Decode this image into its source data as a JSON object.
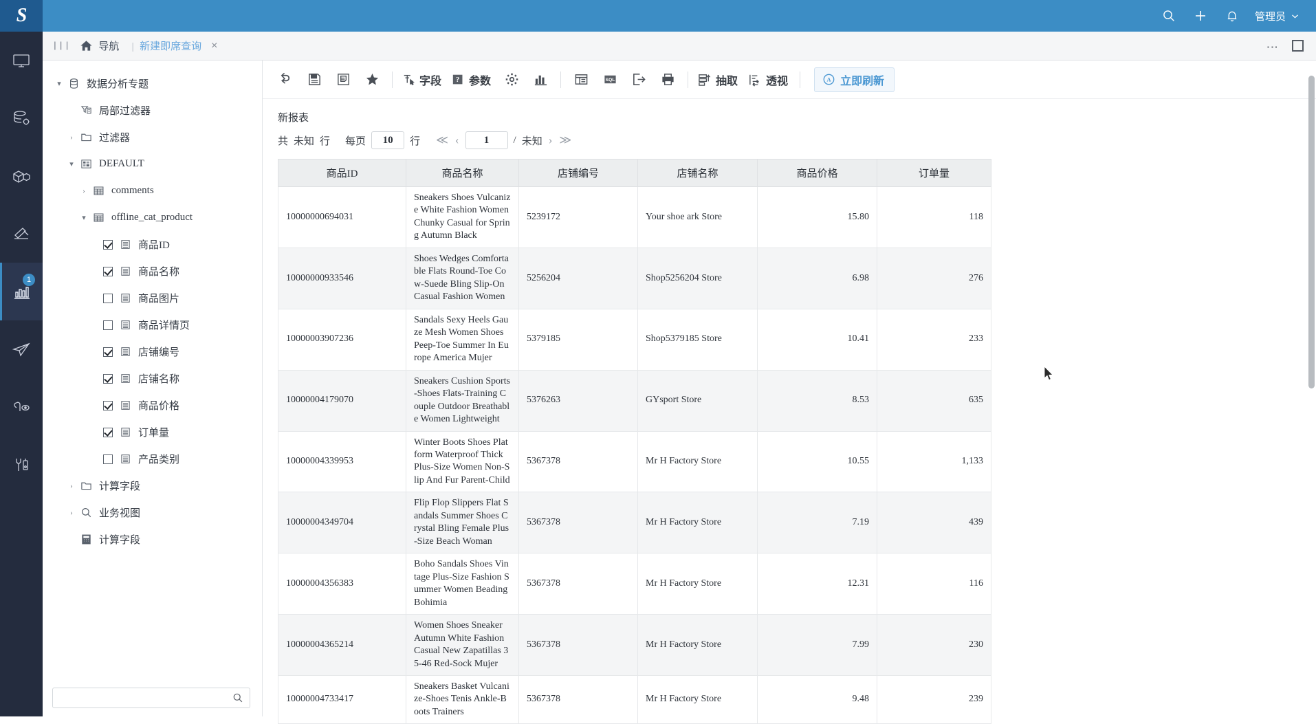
{
  "header": {
    "logo": "S",
    "search_icon": "search-icon",
    "add_icon": "plus-icon",
    "bell_icon": "bell-icon",
    "user_label": "管理员",
    "chevron": "⌄",
    "brand_color": "#3c8dc5"
  },
  "tabbar": {
    "menu_icon": "|||",
    "home_label": "导航",
    "separator": "|",
    "tab_label": "新建即席查询",
    "close_icon": "×",
    "more_icon": "⋮",
    "maximize_icon": "maximize-icon"
  },
  "rail": {
    "items": [
      {
        "name": "monitor",
        "active": false,
        "badge": ""
      },
      {
        "name": "database-gear",
        "active": false,
        "badge": ""
      },
      {
        "name": "cubes",
        "active": false,
        "badge": ""
      },
      {
        "name": "hammer",
        "active": false,
        "badge": ""
      },
      {
        "name": "bar-chart",
        "active": true,
        "badge": "1"
      },
      {
        "name": "paper-plane",
        "active": false,
        "badge": ""
      },
      {
        "name": "share-nodes",
        "active": false,
        "badge": ""
      },
      {
        "name": "tools",
        "active": false,
        "badge": ""
      }
    ]
  },
  "tree": {
    "search_placeholder": "",
    "search_value": "",
    "nodes": [
      {
        "label": "数据分析专题",
        "indent": 0,
        "twisty": "▾",
        "icon": "database-icon",
        "checkbox": null
      },
      {
        "label": "局部过滤器",
        "indent": 1,
        "twisty": "",
        "icon": "filter-local-icon",
        "checkbox": null
      },
      {
        "label": "过滤器",
        "indent": 1,
        "twisty": "›",
        "icon": "folder-icon",
        "checkbox": null
      },
      {
        "label": "DEFAULT",
        "indent": 1,
        "twisty": "▾",
        "icon": "schema-icon",
        "checkbox": null
      },
      {
        "label": "comments",
        "indent": 2,
        "twisty": "›",
        "icon": "table-icon",
        "checkbox": null
      },
      {
        "label": "offline_cat_product",
        "indent": 2,
        "twisty": "▾",
        "icon": "table-icon",
        "checkbox": null
      },
      {
        "label": "商品ID",
        "indent": 3,
        "twisty": "",
        "icon": "field-icon",
        "checkbox": true
      },
      {
        "label": "商品名称",
        "indent": 3,
        "twisty": "",
        "icon": "field-icon",
        "checkbox": true
      },
      {
        "label": "商品图片",
        "indent": 3,
        "twisty": "",
        "icon": "field-icon",
        "checkbox": false
      },
      {
        "label": "商品详情页",
        "indent": 3,
        "twisty": "",
        "icon": "field-icon",
        "checkbox": false
      },
      {
        "label": "店铺编号",
        "indent": 3,
        "twisty": "",
        "icon": "field-icon",
        "checkbox": true
      },
      {
        "label": "店铺名称",
        "indent": 3,
        "twisty": "",
        "icon": "field-icon",
        "checkbox": true
      },
      {
        "label": "商品价格",
        "indent": 3,
        "twisty": "",
        "icon": "field-icon",
        "checkbox": true
      },
      {
        "label": "订单量",
        "indent": 3,
        "twisty": "",
        "icon": "field-icon",
        "checkbox": true
      },
      {
        "label": "产品类别",
        "indent": 3,
        "twisty": "",
        "icon": "field-icon",
        "checkbox": false
      },
      {
        "label": "计算字段",
        "indent": 1,
        "twisty": "›",
        "icon": "folder-icon",
        "checkbox": null
      },
      {
        "label": "业务视图",
        "indent": 1,
        "twisty": "›",
        "icon": "search-icon",
        "checkbox": null
      },
      {
        "label": "计算字段",
        "indent": 1,
        "twisty": "",
        "icon": "calculator-icon",
        "checkbox": null
      }
    ]
  },
  "toolbar": {
    "buttons": [
      {
        "name": "undo-redo-icon",
        "label": "",
        "type": "icon"
      },
      {
        "name": "save-icon",
        "label": "",
        "type": "icon"
      },
      {
        "name": "save-as-icon",
        "label": "",
        "type": "icon"
      },
      {
        "name": "favorite-star-icon",
        "label": "",
        "type": "icon"
      },
      {
        "name": "divider",
        "label": "",
        "type": "divider"
      },
      {
        "name": "field-icon",
        "label": "字段",
        "type": "text"
      },
      {
        "name": "parameter-icon",
        "label": "参数",
        "type": "text"
      },
      {
        "name": "settings-gear-icon",
        "label": "",
        "type": "icon"
      },
      {
        "name": "chart-icon",
        "label": "",
        "type": "icon"
      },
      {
        "name": "divider",
        "label": "",
        "type": "divider"
      },
      {
        "name": "layout-icon",
        "label": "",
        "type": "icon"
      },
      {
        "name": "sql-icon",
        "label": "",
        "type": "icon"
      },
      {
        "name": "export-icon",
        "label": "",
        "type": "icon"
      },
      {
        "name": "print-icon",
        "label": "",
        "type": "icon"
      },
      {
        "name": "divider",
        "label": "",
        "type": "divider"
      },
      {
        "name": "extract-icon",
        "label": "抽取",
        "type": "text"
      },
      {
        "name": "pivot-icon",
        "label": "透视",
        "type": "text"
      },
      {
        "name": "divider",
        "label": "",
        "type": "divider"
      }
    ],
    "refresh": {
      "label": "立即刷新",
      "icon": "auto-refresh-icon"
    }
  },
  "report": {
    "title": "新报表",
    "pager": {
      "total_prefix": "共",
      "total_value": "未知",
      "total_suffix": "行",
      "per_page_label": "每页",
      "per_page_value": "10",
      "per_page_suffix": "行",
      "first_icon": "≪",
      "prev_icon": "‹",
      "page_value": "1",
      "divider": "/",
      "page_total": "未知",
      "next_icon": "›",
      "last_icon": "≫"
    }
  },
  "table": {
    "columns": [
      "商品ID",
      "商品名称",
      "店铺编号",
      "店铺名称",
      "商品价格",
      "订单量"
    ],
    "rows": [
      {
        "id": "10000000694031",
        "name": "Sneakers Shoes Vulcanize White Fashion Women Chunky Casual for Spring Autumn Black",
        "shop_id": "5239172",
        "shop_name": "Your shoe ark Store",
        "price": "15.80",
        "orders": "118"
      },
      {
        "id": "10000000933546",
        "name": "Shoes Wedges Comfortable Flats Round-Toe Cow-Suede Bling Slip-On Casual Fashion Women",
        "shop_id": "5256204",
        "shop_name": "Shop5256204 Store",
        "price": "6.98",
        "orders": "276"
      },
      {
        "id": "10000003907236",
        "name": "Sandals Sexy Heels Gauze Mesh Women Shoes Peep-Toe Summer In Europe America Mujer",
        "shop_id": "5379185",
        "shop_name": "Shop5379185 Store",
        "price": "10.41",
        "orders": "233"
      },
      {
        "id": "10000004179070",
        "name": "Sneakers Cushion Sports-Shoes Flats-Training Couple Outdoor Breathable Women Lightweight",
        "shop_id": "5376263",
        "shop_name": "GYsport Store",
        "price": "8.53",
        "orders": "635"
      },
      {
        "id": "10000004339953",
        "name": "Winter Boots Shoes Platform Waterproof Thick Plus-Size Women Non-Slip And Fur Parent-Child",
        "shop_id": "5367378",
        "shop_name": "Mr H Factory Store",
        "price": "10.55",
        "orders": "1,133"
      },
      {
        "id": "10000004349704",
        "name": "Flip Flop Slippers Flat Sandals Summer Shoes Crystal Bling Female Plus-Size Beach Woman",
        "shop_id": "5367378",
        "shop_name": "Mr H Factory Store",
        "price": "7.19",
        "orders": "439"
      },
      {
        "id": "10000004356383",
        "name": "Boho Sandals Shoes Vintage Plus-Size Fashion Summer Women Beading Bohimia",
        "shop_id": "5367378",
        "shop_name": "Mr H Factory Store",
        "price": "12.31",
        "orders": "116"
      },
      {
        "id": "10000004365214",
        "name": "Women Shoes Sneaker Autumn White Fashion Casual New Zapatillas 35-46 Red-Sock Mujer",
        "shop_id": "5367378",
        "shop_name": "Mr H Factory Store",
        "price": "7.99",
        "orders": "230"
      },
      {
        "id": "10000004733417",
        "name": "Sneakers Basket Vulcanize-Shoes Tenis Ankle-Boots Trainers",
        "shop_id": "5367378",
        "shop_name": "Mr H Factory Store",
        "price": "9.48",
        "orders": "239"
      }
    ]
  }
}
